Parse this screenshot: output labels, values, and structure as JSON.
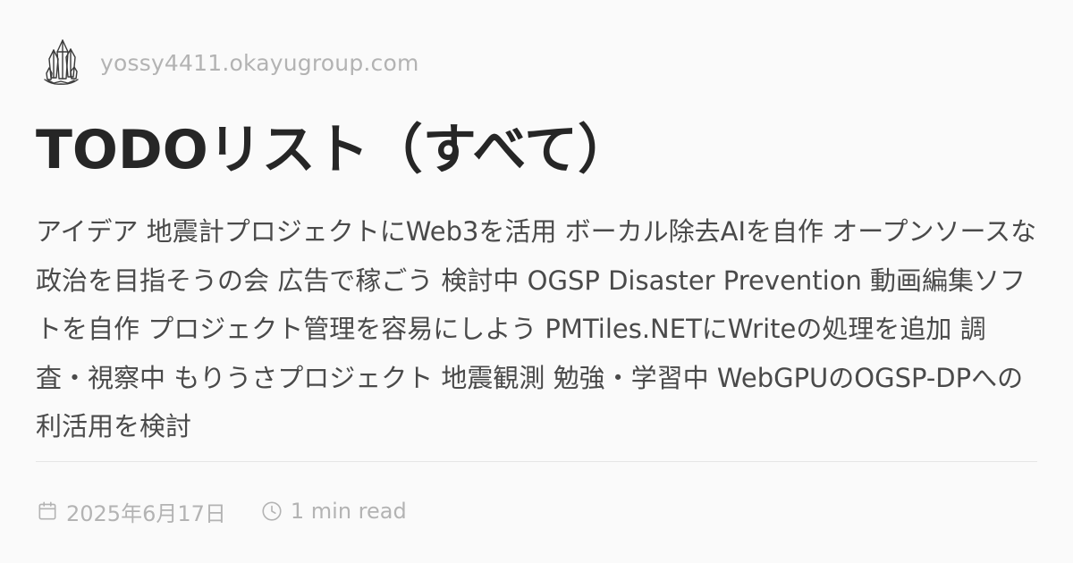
{
  "site": {
    "domain": "yossy4411.okayugroup.com",
    "logo_icon": "crystal-logo-icon"
  },
  "post": {
    "title": "TODOリスト（すべて）",
    "description": "アイデア 地震計プロジェクトにWeb3を活用 ボーカル除去AIを自作 オープンソースな政治を目指そうの会 広告で稼ごう 検討中 OGSP Disaster Prevention 動画編集ソフトを自作 プロジェクト管理を容易にしよう PMTiles.NETにWriteの処理を追加 調査・視察中 もりうさプロジェクト 地震観測 勉強・学習中 WebGPUのOGSP-DPへの利活用を検討",
    "date": "2025年6月17日",
    "read_time": "1 min read"
  },
  "icons": {
    "date": "calendar-icon",
    "read_time": "clock-icon"
  },
  "colors": {
    "background": "#fafafa",
    "title": "#262626",
    "description": "#4a4a4a",
    "muted": "#b3b3b3",
    "divider": "#e6e6e6"
  }
}
